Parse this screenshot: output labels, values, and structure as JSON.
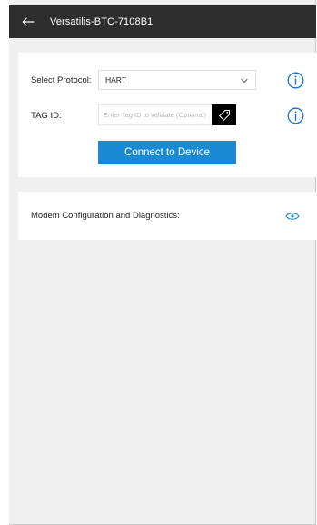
{
  "app": {
    "title": "Versatilis-BTC-7108B1",
    "back_icon": "arrow-left-icon",
    "colors": {
      "appbar": "#2e2e2e",
      "background": "#f0f0f0",
      "accent": "#1a8ad4",
      "info_icon": "#1a73c9"
    }
  },
  "protocol": {
    "label": "Select Protocol:",
    "selected": "HART",
    "info_icon": "info-circle-icon"
  },
  "tag": {
    "label": "TAG ID:",
    "value": "",
    "placeholder": "Enter Tag ID to validate (Optional)",
    "tag_icon": "tag-icon",
    "info_icon": "info-circle-icon"
  },
  "connect": {
    "label": "Connect to Device"
  },
  "modem": {
    "label": "Modem Configuration and Diagnostics:",
    "icon": "eye-icon"
  }
}
